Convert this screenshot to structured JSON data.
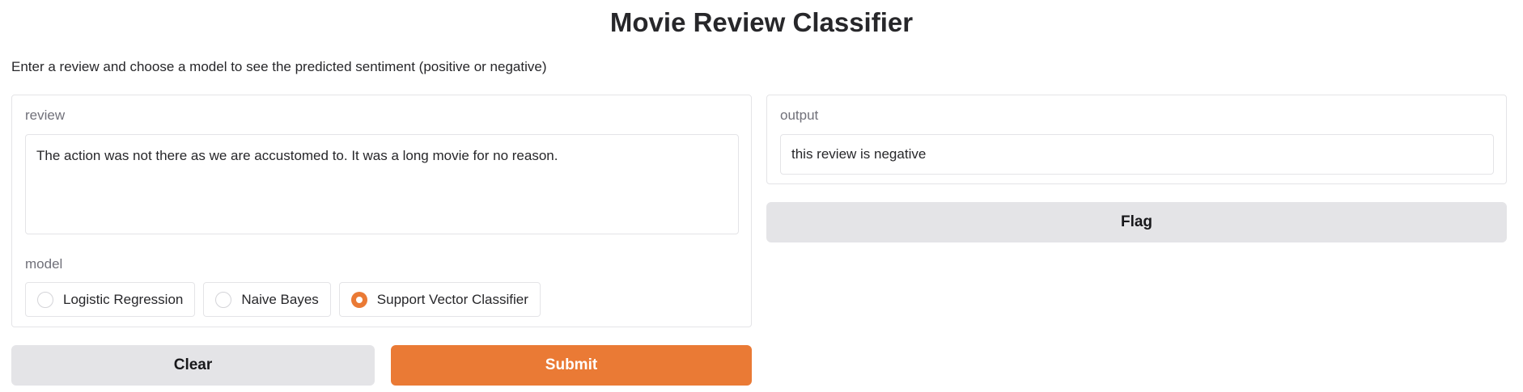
{
  "page": {
    "title": "Movie Review Classifier",
    "description": "Enter a review and choose a model to see the predicted sentiment (positive or negative)"
  },
  "inputs": {
    "review_label": "review",
    "review_value": "The action was not there as we are accustomed to. It was a long movie for no reason.",
    "model_label": "model",
    "model_options": [
      "Logistic Regression",
      "Naive Bayes",
      "Support Vector Classifier"
    ],
    "model_selected": "Support Vector Classifier"
  },
  "outputs": {
    "output_label": "output",
    "output_value": "this review is negative"
  },
  "buttons": {
    "clear": "Clear",
    "submit": "Submit",
    "flag": "Flag"
  },
  "colors": {
    "accent": "#ea7a35",
    "secondary_button": "#e4e4e7",
    "border": "#e4e4e7",
    "label": "#71717a"
  }
}
